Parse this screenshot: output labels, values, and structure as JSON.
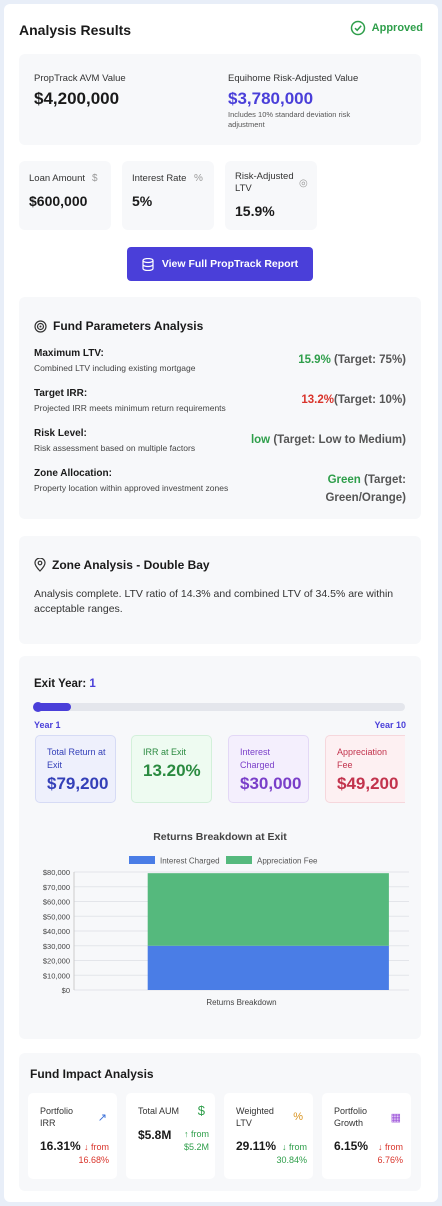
{
  "header": {
    "title": "Analysis Results",
    "status": "Approved"
  },
  "valuation": {
    "avm_label": "PropTrack AVM Value",
    "avm_value": "$4,200,000",
    "risk_label": "Equihome Risk-Adjusted Value",
    "risk_value": "$3,780,000",
    "risk_note": "Includes 10% standard deviation risk adjustment"
  },
  "loan_cards": [
    {
      "label": "Loan Amount",
      "value": "$600,000",
      "icon": "$"
    },
    {
      "label": "Interest Rate",
      "value": "5%",
      "icon": "%"
    },
    {
      "label": "Risk-Adjusted LTV",
      "value": "15.9%",
      "icon": "◎"
    }
  ],
  "report_button": "View Full PropTrack Report",
  "fund_params": {
    "title": "Fund Parameters Analysis",
    "rows": [
      {
        "label": "Maximum LTV:",
        "desc": "Combined LTV including existing mortgage",
        "value": "15.9%",
        "target": "(Target: 75%)",
        "color": "#2e9e4a"
      },
      {
        "label": "Target IRR:",
        "desc": "Projected IRR meets minimum return requirements",
        "value": "13.2%",
        "target": "(Target: 10%)",
        "color": "#d9342b"
      },
      {
        "label": "Risk Level:",
        "desc": "Risk assessment based on multiple factors",
        "value": "low",
        "target": "(Target: Low to Medium)",
        "color": "#2e9e4a"
      },
      {
        "label": "Zone Allocation:",
        "desc": "Property location within approved investment zones",
        "value": "Green",
        "target": "(Target: Green/Orange)",
        "color": "#2e9e4a"
      }
    ]
  },
  "zone": {
    "title": "Zone Analysis - Double Bay",
    "text": "Analysis complete. LTV ratio of 14.3% and combined LTV of 34.5% are within acceptable ranges."
  },
  "exit": {
    "label": "Exit Year:",
    "year": "1",
    "slider_fraction": 0.1,
    "min_label": "Year 1",
    "max_label": "Year 10",
    "stats": [
      {
        "label": "Total Return at Exit",
        "value": "$79,200",
        "bg": "#eef0fc",
        "border": "#d6dbf5",
        "fg": "#3440b8",
        "labelfg": "#3440b8"
      },
      {
        "label": "IRR at Exit",
        "value": "13.20%",
        "bg": "#eefbf1",
        "border": "#d3f0da",
        "fg": "#2a8a40",
        "labelfg": "#2a8a40"
      },
      {
        "label": "Interest Charged",
        "value": "$30,000",
        "bg": "#f4effd",
        "border": "#e3d8f6",
        "fg": "#7a3fc9",
        "labelfg": "#7a3fc9"
      },
      {
        "label": "Appreciation Fee",
        "value": "$49,200",
        "bg": "#fdf0f2",
        "border": "#f6d7dc",
        "fg": "#c2334d",
        "labelfg": "#c2334d"
      }
    ]
  },
  "chart_data": {
    "type": "bar",
    "stacked": true,
    "title": "Returns Breakdown at Exit",
    "categories": [
      "Returns Breakdown"
    ],
    "series": [
      {
        "name": "Interest Charged",
        "values": [
          30000
        ],
        "color": "#4a7de6"
      },
      {
        "name": "Appreciation Fee",
        "values": [
          49200
        ],
        "color": "#55b97d"
      }
    ],
    "ylim": [
      0,
      80000
    ],
    "yticks": [
      "$0",
      "$10,000",
      "$20,000",
      "$30,000",
      "$40,000",
      "$50,000",
      "$60,000",
      "$70,000",
      "$80,000"
    ],
    "legend": "top",
    "grid": true
  },
  "impact": {
    "title": "Fund Impact Analysis",
    "cards": [
      {
        "label": "Portfolio IRR",
        "value": "16.31%",
        "arrow": "↓",
        "from": "from",
        "prev": "16.68%",
        "color": "#d9342b",
        "icon": "↗",
        "iconcolor": "#3a6fd8"
      },
      {
        "label": "Total AUM",
        "value": "$5.8M",
        "arrow": "↑",
        "from": "from",
        "prev": "$5.2M",
        "color": "#2e9e4a",
        "icon": "$",
        "iconcolor": "#2e9e4a"
      },
      {
        "label": "Weighted LTV",
        "value": "29.11%",
        "arrow": "↓",
        "from": "from",
        "prev": "30.84%",
        "color": "#2e9e4a",
        "icon": "%",
        "iconcolor": "#d9931f"
      },
      {
        "label": "Portfolio Growth",
        "value": "6.15%",
        "arrow": "↓",
        "from": "from",
        "prev": "6.76%",
        "color": "#d9342b",
        "icon": "▦",
        "iconcolor": "#9a4fd9"
      }
    ]
  }
}
